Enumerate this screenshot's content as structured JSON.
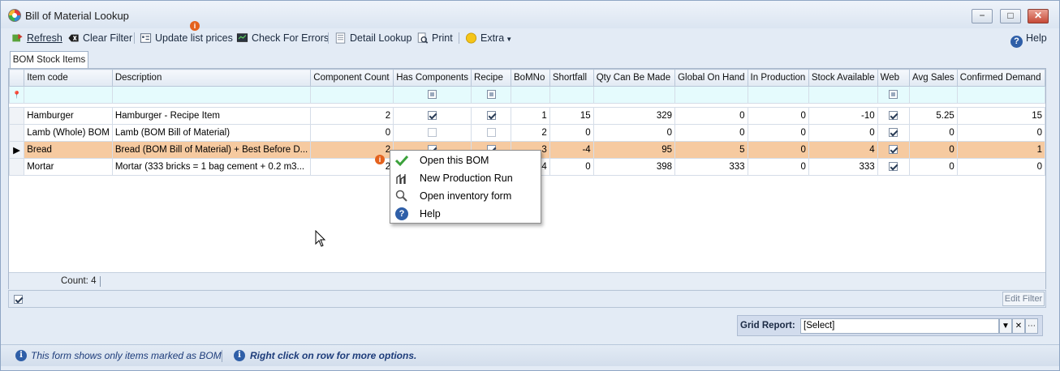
{
  "window": {
    "title": "Bill of Material Lookup",
    "controls": {
      "minimize": "−",
      "maximize": "□",
      "close": "✕"
    }
  },
  "toolbar": {
    "refresh": "Refresh",
    "clear_filter": "Clear Filter",
    "update_list_prices": "Update list prices",
    "check_for_errors": "Check For Errors",
    "detail_lookup": "Detail Lookup",
    "print": "Print",
    "extra": "Extra",
    "help": "Help",
    "badge": "i"
  },
  "tabs": [
    "BOM Stock Items"
  ],
  "grid": {
    "columns": [
      "Item code",
      "Description",
      "Component Count",
      "Has Components",
      "Recipe",
      "BoMNo",
      "Shortfall",
      "Qty Can Be Made",
      "Global On Hand",
      "In Production",
      "Stock Available",
      "Web",
      "Avg Sales",
      "Confirmed Demand"
    ],
    "rows": [
      {
        "item_code": "Hamburger",
        "description": "Hamburger - Recipe Item",
        "component_count": "2",
        "has_components": true,
        "recipe": true,
        "bomno": "1",
        "shortfall": "15",
        "qty_can_be_made": "329",
        "global_on_hand": "0",
        "in_production": "0",
        "stock_available": "-10",
        "web": true,
        "avg_sales": "5.25",
        "confirmed_demand": "15"
      },
      {
        "item_code": "Lamb (Whole) BOM",
        "description": "Lamb (BOM Bill of Material)",
        "component_count": "0",
        "has_components": false,
        "recipe": false,
        "bomno": "2",
        "shortfall": "0",
        "qty_can_be_made": "0",
        "global_on_hand": "0",
        "in_production": "0",
        "stock_available": "0",
        "web": true,
        "avg_sales": "0",
        "confirmed_demand": "0"
      },
      {
        "item_code": "Bread",
        "description": "Bread (BOM Bill of Material) + Best Before D...",
        "component_count": "2",
        "has_components": true,
        "recipe": true,
        "bomno": "3",
        "shortfall": "-4",
        "qty_can_be_made": "95",
        "global_on_hand": "5",
        "in_production": "0",
        "stock_available": "4",
        "web": true,
        "avg_sales": "0",
        "confirmed_demand": "1",
        "selected": true
      },
      {
        "item_code": "Mortar",
        "description": "Mortar (333 bricks = 1 bag cement + 0.2 m3...",
        "component_count": "2",
        "has_components": true,
        "recipe": true,
        "bomno": "4",
        "shortfall": "0",
        "qty_can_be_made": "398",
        "global_on_hand": "333",
        "in_production": "0",
        "stock_available": "333",
        "web": true,
        "avg_sales": "0",
        "confirmed_demand": "0"
      }
    ],
    "count_label": "Count: 4"
  },
  "filter_bar": {
    "edit_filter": "Edit Filter"
  },
  "grid_report": {
    "label": "Grid Report:",
    "value": "[Select]"
  },
  "context_menu": {
    "items": [
      {
        "label": "Open this BOM",
        "icon": "checkmark-icon"
      },
      {
        "label": "New Production Run",
        "icon": "production-icon"
      },
      {
        "label": "Open inventory form",
        "icon": "magnifier-icon"
      },
      {
        "label": "Help",
        "icon": "help-icon"
      }
    ]
  },
  "status": {
    "left": "This form shows only  items marked as BOM",
    "right": "Right click on row for more options."
  },
  "colors": {
    "selected_row": "#f6caa0",
    "filter_row": "#e5fbfd",
    "accent": "#2f5fa8"
  }
}
